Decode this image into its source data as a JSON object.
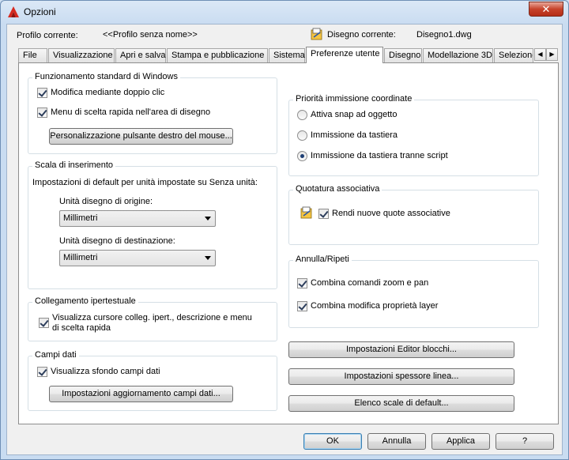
{
  "window": {
    "title": "Opzioni",
    "close_glyph": "✕",
    "app_icon": "autocad-logo-icon"
  },
  "profile": {
    "current_profile_label": "Profilo corrente:",
    "current_profile_value": "<<Profilo senza nome>>",
    "current_drawing_label": "Disegno corrente:",
    "current_drawing_value": "Disegno1.dwg",
    "drawing_icon": "drawing-file-icon"
  },
  "tabs": [
    {
      "label": "File"
    },
    {
      "label": "Visualizzazione"
    },
    {
      "label": "Apri e salva"
    },
    {
      "label": "Stampa e pubblicazione"
    },
    {
      "label": "Sistema"
    },
    {
      "label": "Preferenze utente",
      "active": true
    },
    {
      "label": "Disegno"
    },
    {
      "label": "Modellazione 3D"
    },
    {
      "label": "Selezione"
    }
  ],
  "tab_scroll": {
    "left": "◀",
    "right": "▶"
  },
  "windows_std": {
    "title": "Funzionamento standard di Windows",
    "double_click_label": "Modifica mediante doppio clic",
    "double_click_checked": true,
    "shortcut_menu_label": "Menu di scelta rapida nell'area di disegno",
    "shortcut_menu_checked": true,
    "right_click_button": "Personalizzazione pulsante destro del mouse..."
  },
  "insert_scale": {
    "title": "Scala di inserimento",
    "default_text": "Impostazioni di default per unità impostate su Senza unità:",
    "source_label": "Unità disegno di origine:",
    "source_value": "Millimetri",
    "target_label": "Unità disegno di destinazione:",
    "target_value": "Millimetri"
  },
  "hyperlink": {
    "title": "Collegamento ipertestuale",
    "show_cursor_label_line1": "Visualizza cursore colleg. ipert., descrizione e menu",
    "show_cursor_label_line2": "di scelta rapida",
    "show_cursor_checked": true
  },
  "fields": {
    "title": "Campi dati",
    "background_label": "Visualizza sfondo campi dati",
    "background_checked": true,
    "update_button": "Impostazioni aggiornamento campi dati..."
  },
  "coord_priority": {
    "title": "Priorità immissione coordinate",
    "options": [
      {
        "label": "Attiva snap ad oggetto",
        "selected": false
      },
      {
        "label": "Immissione da tastiera",
        "selected": false
      },
      {
        "label": "Immissione da tastiera tranne script",
        "selected": true
      }
    ]
  },
  "assoc_dim": {
    "title": "Quotatura associativa",
    "new_assoc_label": "Rendi nuove quote associative",
    "new_assoc_checked": true,
    "icon": "drawing-file-icon"
  },
  "undo_redo": {
    "title": "Annulla/Ripeti",
    "combine_zoom_label": "Combina comandi zoom e pan",
    "combine_zoom_checked": true,
    "combine_layer_label": "Combina modifica proprietà layer",
    "combine_layer_checked": true
  },
  "side_buttons": {
    "block_editor": "Impostazioni Editor blocchi...",
    "lineweight": "Impostazioni spessore linea...",
    "default_scale": "Elenco scale di default..."
  },
  "footer": {
    "ok": "OK",
    "cancel": "Annulla",
    "apply": "Applica",
    "help": "?"
  }
}
